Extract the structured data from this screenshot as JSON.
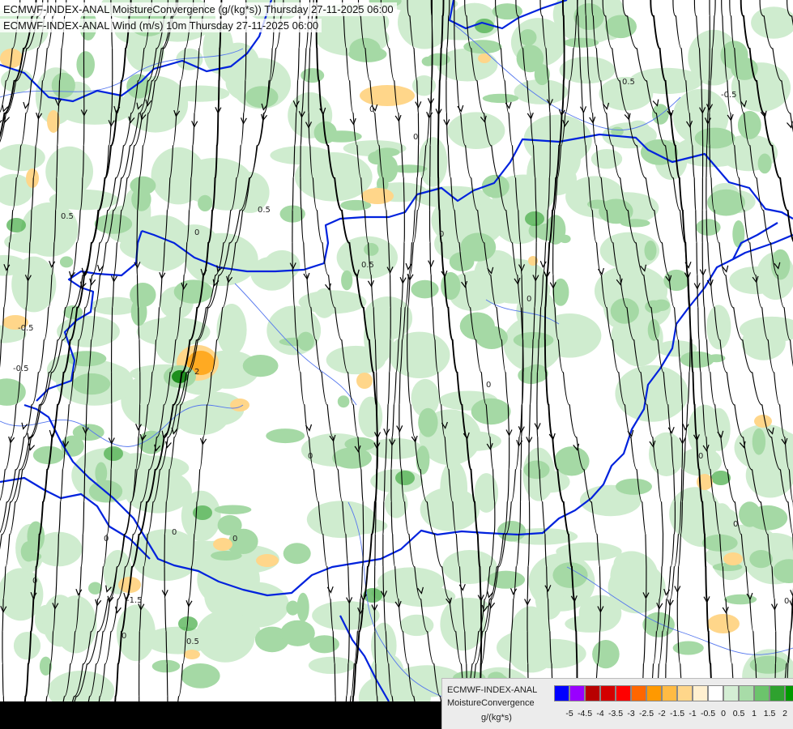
{
  "header": {
    "line1": "ECMWF-INDEX-ANAL MoistureConvergence (g/(kg*s)) Thursday 27-11-2025 06:00",
    "line2": "ECMWF-INDEX-ANAL Wind (m/s) 10m Thursday 27-11-2025 06:00"
  },
  "legend": {
    "title_model": "ECMWF-INDEX-ANAL",
    "title_field": "MoistureConvergence",
    "units": "g/(kg*s)",
    "swatch_colors": [
      "#0000ff",
      "#9900ff",
      "#b80000",
      "#d40000",
      "#ff0000",
      "#ff6600",
      "#ff9900",
      "#ffbb44",
      "#ffd68a",
      "#fff0d0",
      "#ffffff",
      "#d4eed4",
      "#a8dca8",
      "#6cc46c",
      "#2fa22f",
      "#009900"
    ],
    "tick_labels": [
      "-5",
      "-4.5",
      "-4",
      "-3.5",
      "-3",
      "-2.5",
      "-2",
      "-1.5",
      "-1",
      "-0.5",
      "0",
      "0.5",
      "1",
      "1.5",
      "2"
    ]
  },
  "contour_labels": [
    "0",
    "-0.5",
    "0.5",
    "-1.5",
    "2",
    "0.5",
    "0",
    "0",
    "-0.5",
    "0",
    "0",
    "0",
    "0",
    "0",
    "0.5",
    "-0.5",
    "0.5",
    "0",
    "0",
    "0",
    "0",
    "0",
    "0",
    "0",
    "0.5"
  ],
  "colors": {
    "border": "#0022dd",
    "river": "#5577ee",
    "streamline": "#000000",
    "green_light": "#cfeccf",
    "green_mid": "#a5d9a5",
    "green_dark": "#4fb04f",
    "orange_light": "#ffd68a",
    "orange_mid": "#ffaa22"
  }
}
